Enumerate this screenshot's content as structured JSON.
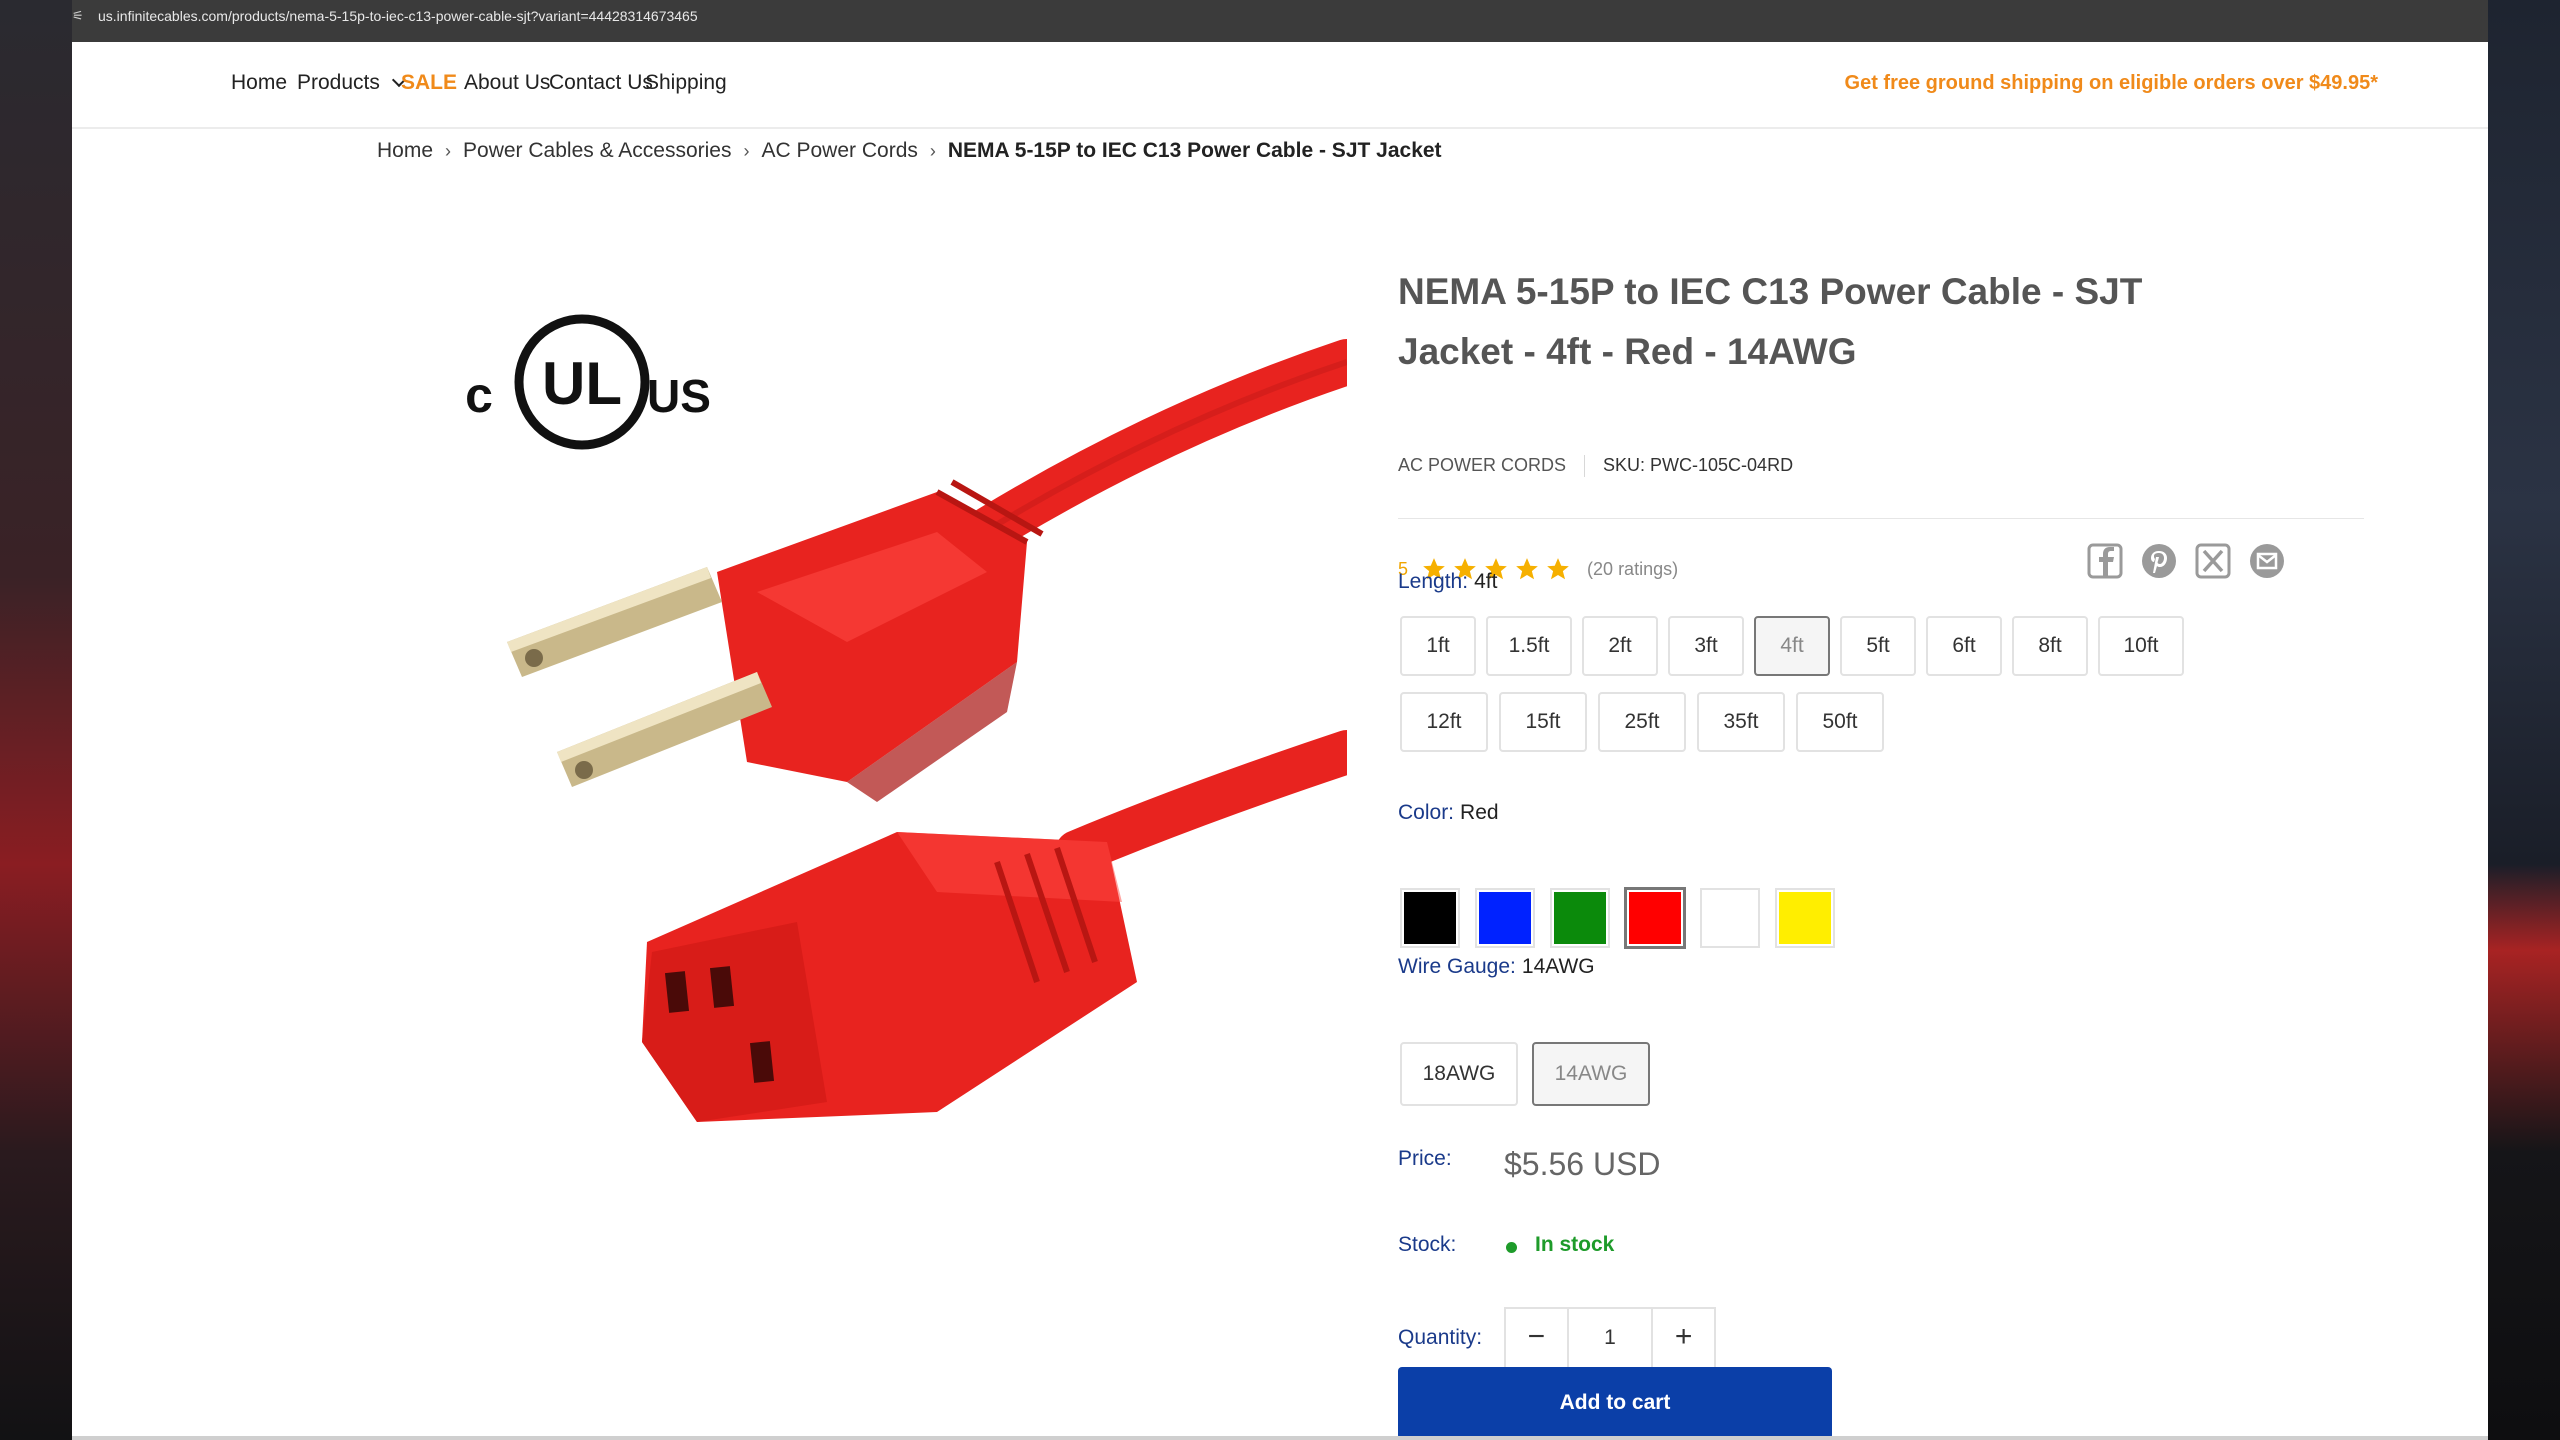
{
  "browser": {
    "url": "us.infinitecables.com/products/nema-5-15p-to-iec-c13-power-cable-sjt?variant=44428314673465",
    "tune_icon": "tune-icon"
  },
  "nav": {
    "home": "Home",
    "products": "Products",
    "sale": "SALE",
    "about": "About Us",
    "contact": "Contact Us",
    "shipping": "Shipping",
    "promo": "Get free ground shipping on eligible orders over $49.95*"
  },
  "breadcrumb": {
    "sep": "›",
    "items": [
      "Home",
      "Power Cables & Accessories",
      "AC Power Cords"
    ],
    "current": "NEMA 5-15P to IEC C13 Power Cable - SJT Jacket"
  },
  "product": {
    "title": "NEMA 5-15P to IEC C13 Power Cable - SJT Jacket - 4ft - Red - 14AWG",
    "vendor": "AC Power Cords",
    "sku": "SKU: PWC-105C-04RD",
    "rating_value": "5",
    "stars": 5,
    "ratings_count": "(20 ratings)",
    "certification": {
      "left": "c",
      "center": "UL",
      "right": "US"
    }
  },
  "share": [
    "facebook-icon",
    "pinterest-icon",
    "x-icon",
    "email-icon"
  ],
  "options": {
    "length": {
      "label": "Length:",
      "selected": "4ft",
      "values": [
        "1ft",
        "1.5ft",
        "2ft",
        "3ft",
        "4ft",
        "5ft",
        "6ft",
        "8ft",
        "10ft",
        "12ft",
        "15ft",
        "25ft",
        "35ft",
        "50ft"
      ]
    },
    "color": {
      "label": "Color:",
      "selected": "Red",
      "swatches": [
        {
          "name": "Black",
          "hex": "#000000"
        },
        {
          "name": "Blue",
          "hex": "#0022ff"
        },
        {
          "name": "Green",
          "hex": "#0b8a0b"
        },
        {
          "name": "Red",
          "hex": "#ff0000"
        },
        {
          "name": "White",
          "hex": "#ffffff"
        },
        {
          "name": "Yellow",
          "hex": "#ffee00"
        }
      ]
    },
    "gauge": {
      "label": "Wire Gauge:",
      "selected": "14AWG",
      "values": [
        "18AWG",
        "14AWG"
      ]
    }
  },
  "price": {
    "label": "Price:",
    "value": "$5.56 USD"
  },
  "stock": {
    "label": "Stock:",
    "value": "In stock"
  },
  "quantity": {
    "label": "Quantity:",
    "value": "1",
    "minus": "−",
    "plus": "+"
  },
  "cart": {
    "label": "Add to cart"
  },
  "colors": {
    "accent_orange": "#f08a1a",
    "label_blue": "#1a3a8a",
    "cart_blue": "#0b3fa8",
    "stock_green": "#1e9b2a",
    "cable_red": "#e8231f"
  }
}
